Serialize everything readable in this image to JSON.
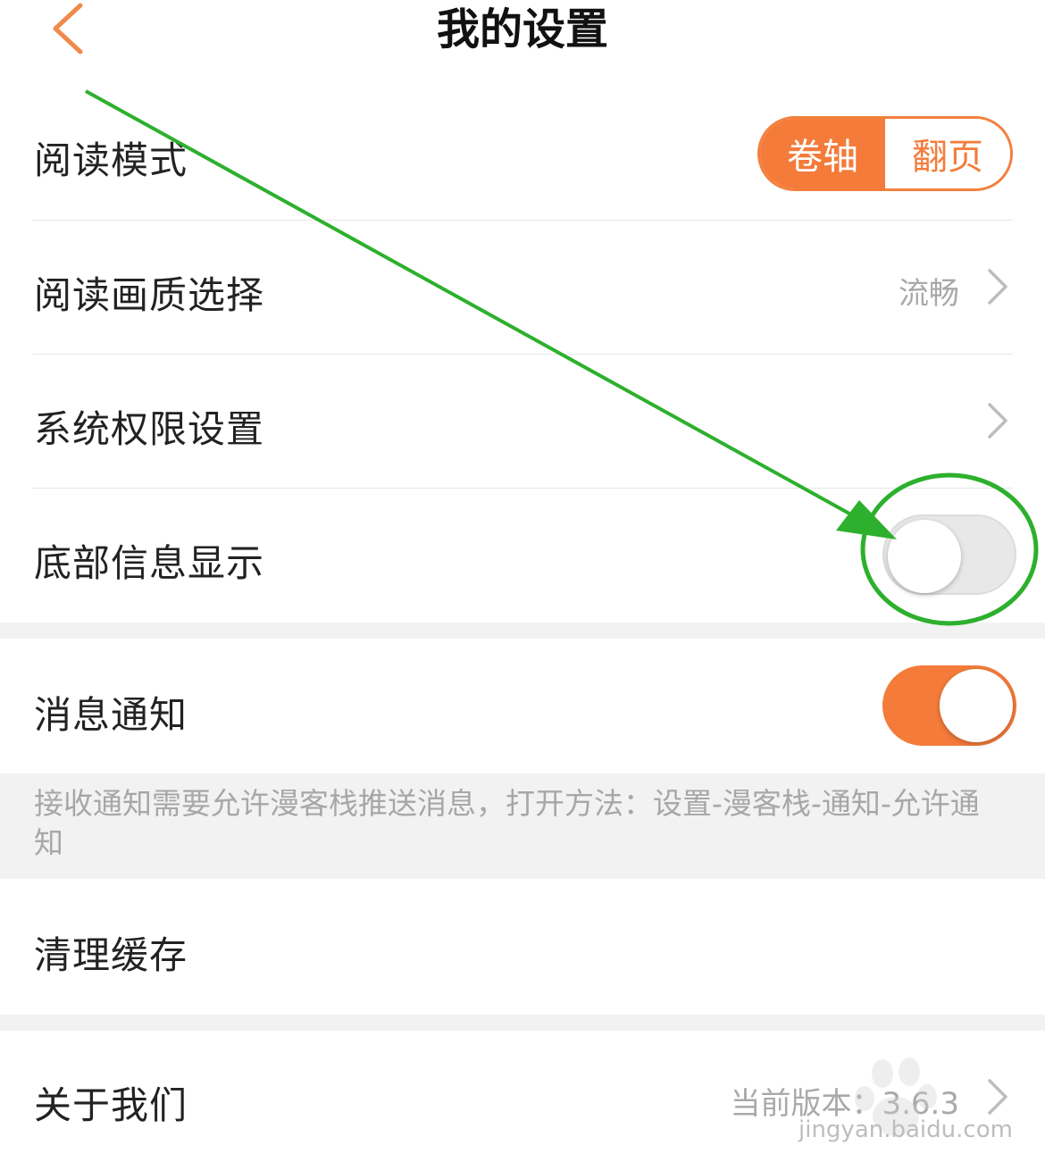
{
  "header": {
    "title": "我的设置"
  },
  "settings": {
    "reading_mode": {
      "label": "阅读模式",
      "option_active": "卷轴",
      "option_inactive": "翻页"
    },
    "image_quality": {
      "label": "阅读画质选择",
      "value": "流畅"
    },
    "system_permissions": {
      "label": "系统权限设置"
    },
    "bottom_info": {
      "label": "底部信息显示",
      "enabled": false
    },
    "notifications": {
      "label": "消息通知",
      "enabled": true,
      "hint": "接收通知需要允许漫客栈推送消息，打开方法：设置-漫客栈-通知-允许通知"
    },
    "clear_cache": {
      "label": "清理缓存"
    },
    "about": {
      "label": "关于我们",
      "value": "当前版本：3.6.3"
    }
  },
  "watermark": {
    "text": "jingyan.baidu.com"
  },
  "colors": {
    "accent": "#f47b3a",
    "annotation": "#2db02d",
    "muted": "#a9a9a9",
    "section_bg": "#f2f2f2"
  },
  "icons": {
    "back": "chevron-left-icon",
    "forward": "chevron-right-icon"
  }
}
